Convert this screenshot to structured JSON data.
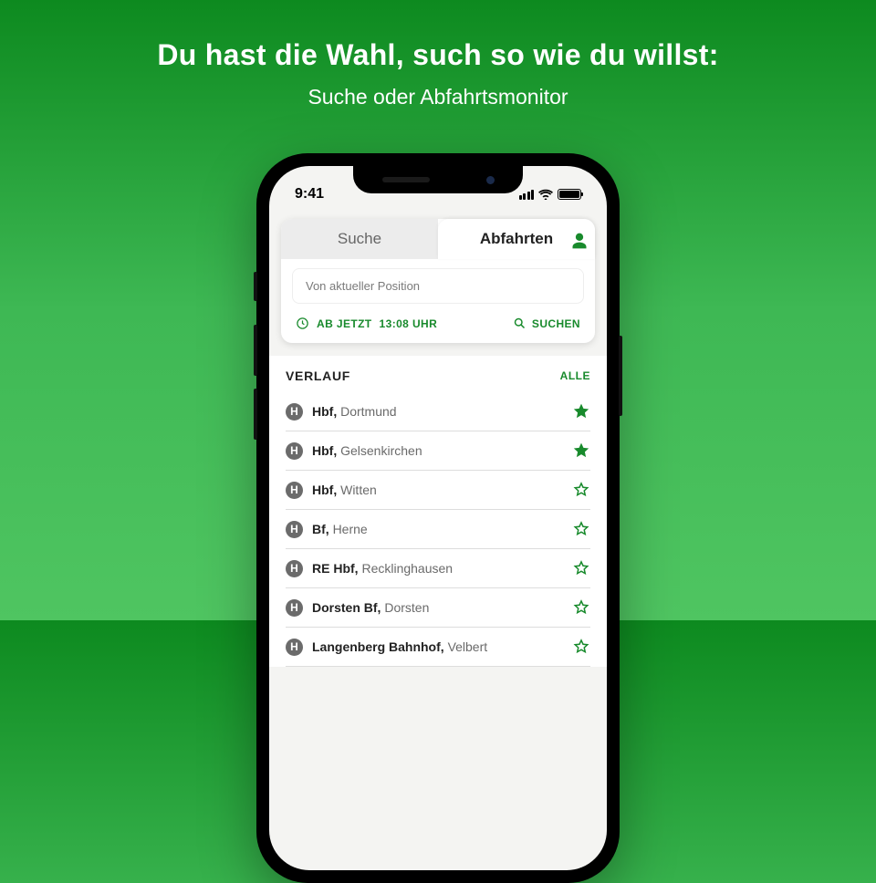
{
  "promo": {
    "headline": "Du hast die Wahl, such so wie du willst:",
    "subheadline": "Suche oder Abfahrtsmonitor"
  },
  "statusbar": {
    "time": "9:41"
  },
  "tabs": {
    "search": "Suche",
    "departures": "Abfahrten"
  },
  "search": {
    "placeholder": "Von aktueller Position"
  },
  "timebar": {
    "from_now": "AB JETZT",
    "time": "13:08 UHR",
    "search_label": "SUCHEN"
  },
  "history": {
    "title": "VERLAUF",
    "all_label": "ALLE",
    "items": [
      {
        "badge": "H",
        "bold": "Hbf,",
        "rest": "Dortmund",
        "fav": true
      },
      {
        "badge": "H",
        "bold": "Hbf,",
        "rest": "Gelsenkirchen",
        "fav": true
      },
      {
        "badge": "H",
        "bold": "Hbf,",
        "rest": "Witten",
        "fav": false
      },
      {
        "badge": "H",
        "bold": "Bf,",
        "rest": "Herne",
        "fav": false
      },
      {
        "badge": "H",
        "bold": "RE Hbf,",
        "rest": "Recklinghausen",
        "fav": false
      },
      {
        "badge": "H",
        "bold": "Dorsten Bf,",
        "rest": "Dorsten",
        "fav": false
      },
      {
        "badge": "H",
        "bold": "Langenberg Bahnhof,",
        "rest": "Velbert",
        "fav": false
      }
    ]
  },
  "colors": {
    "brand": "#188a2c"
  }
}
